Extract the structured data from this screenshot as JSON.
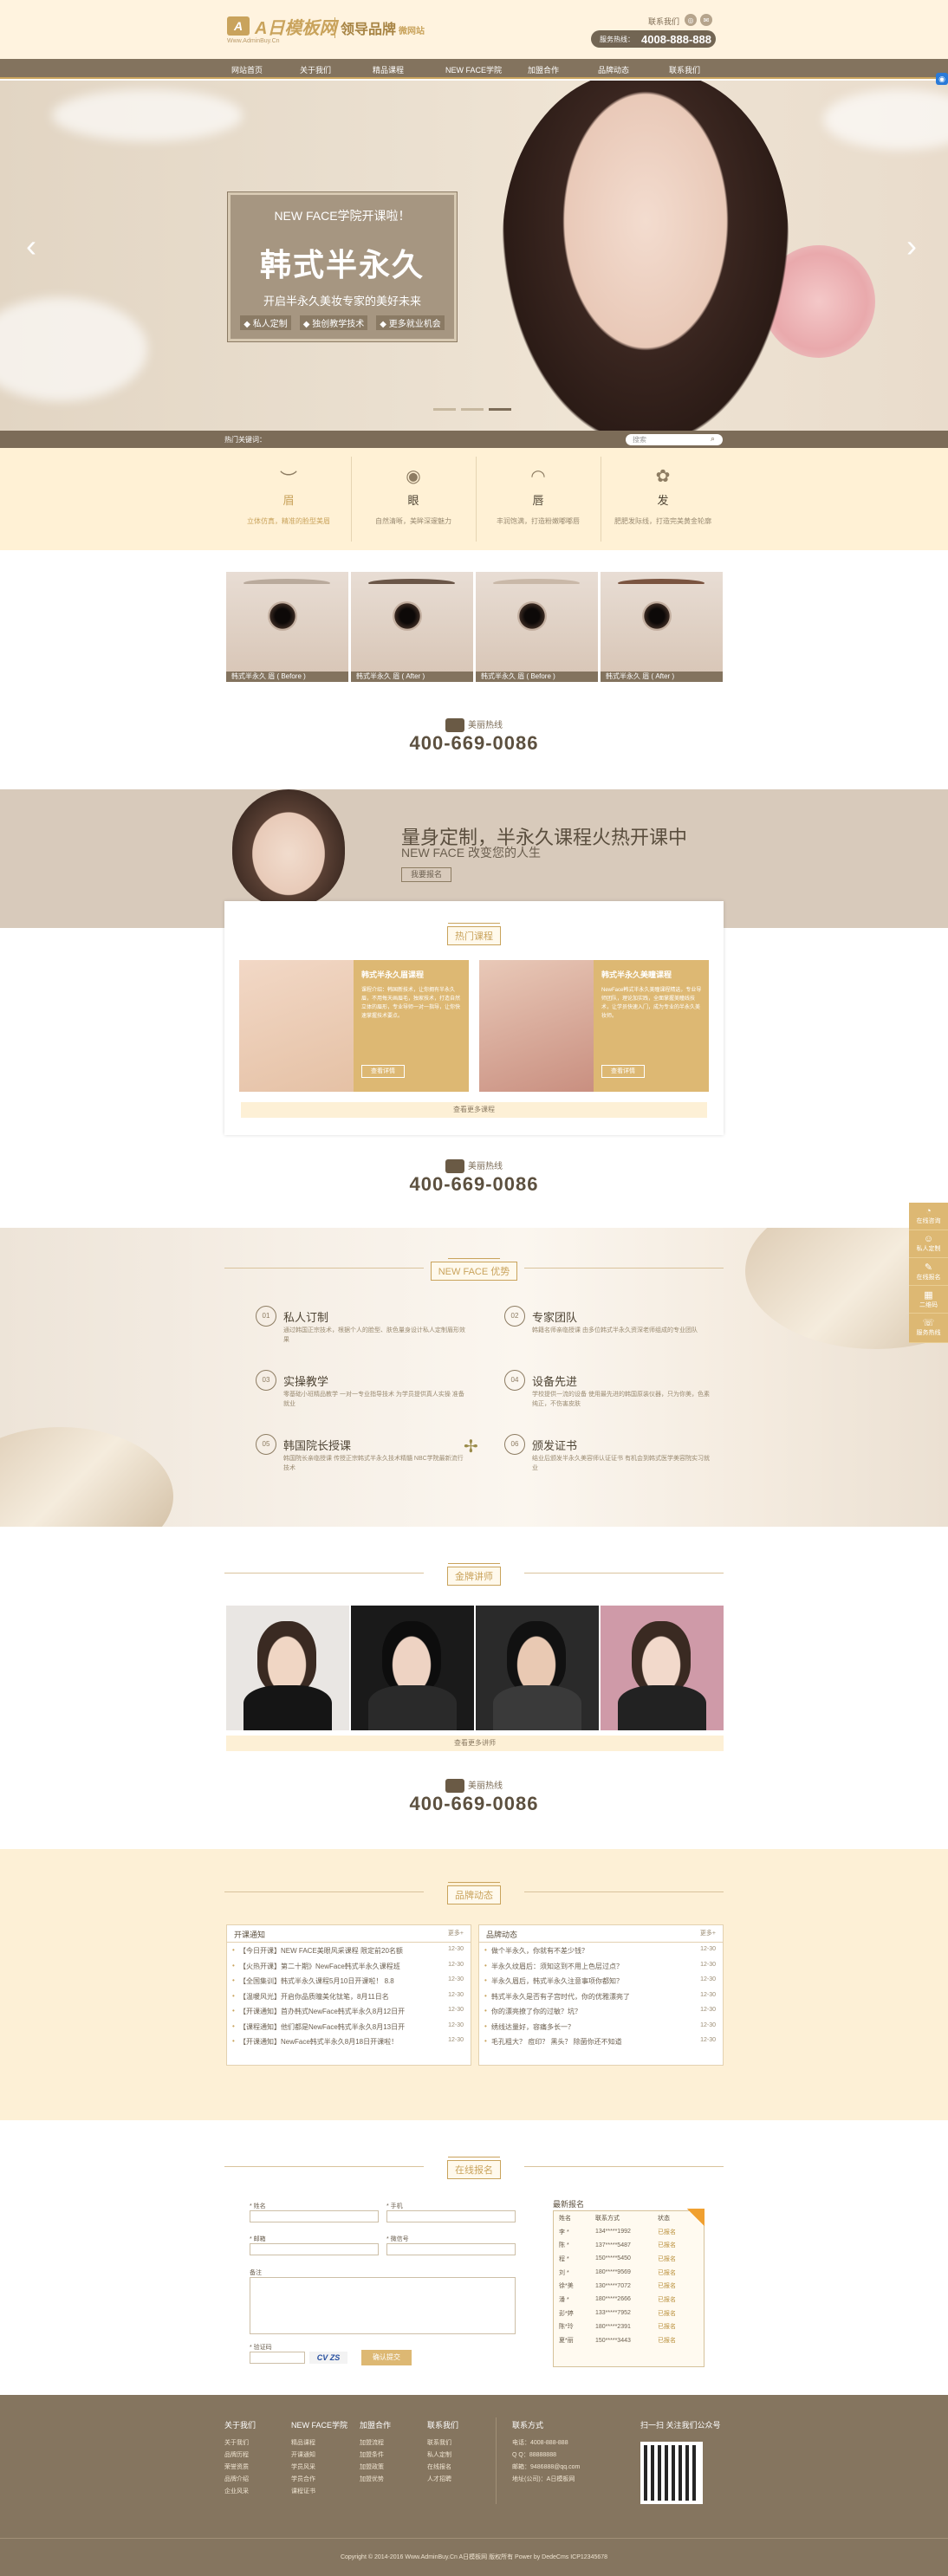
{
  "header": {
    "logo_text": "A日模板网",
    "logo_sub": "Www.AdminBuy.Cn",
    "slogan": "领导品牌",
    "slogan_small": "微网站",
    "toplinks": "联系我们",
    "hotline_label": "服务热线：",
    "hotline_number": "4008-888-888"
  },
  "nav": {
    "items": [
      "网站首页",
      "关于我们",
      "精品课程",
      "NEW FACE学院",
      "加盟合作",
      "品牌动态",
      "联系我们"
    ]
  },
  "banner": {
    "title_small": "NEW FACE学院开课啦！",
    "title_big": "韩式半永久",
    "subtitle": "开启半永久美妆专家的美好未来",
    "tags": [
      "◆ 私人定制",
      "◆ 独创教学技术",
      "◆ 更多就业机会"
    ]
  },
  "keyword": {
    "label": "热门关键词：",
    "search_placeholder": "搜索"
  },
  "features": [
    {
      "icon": "brow-icon",
      "title": "眉",
      "desc": "立体仿真，精准的脸型美眉",
      "glyph": "︶"
    },
    {
      "icon": "eye-icon",
      "title": "眼",
      "desc": "自然清晰，美眸深邃魅力",
      "glyph": "◉"
    },
    {
      "icon": "lip-icon",
      "title": "唇",
      "desc": "丰润饱满，打造粉嫩嘟嘟唇",
      "glyph": "◠"
    },
    {
      "icon": "hair-icon",
      "title": "发",
      "desc": "肥肥发际线，打造完美黄金轮廓",
      "glyph": "✿"
    }
  ],
  "eye_captions": [
    "韩式半永久 眉 ( Before )",
    "韩式半永久 眉 ( After )",
    "韩式半永久 眉 ( Before )",
    "韩式半永久 眉 ( After )"
  ],
  "hotline_block": {
    "label": "美丽热线",
    "number": "400-669-0086"
  },
  "promo": {
    "heading": "量身定制，半永久课程火热开课中",
    "sub": "NEW FACE  改变您的人生",
    "button": "我要报名"
  },
  "courses": {
    "title": "热门课程",
    "cards": [
      {
        "name": "韩式半永久眉课程",
        "desc": "课程介绍：韩国新技术，让你拥有半永久眉，不用每天画眉毛，独家技术，打造自然立体的眉形，专业导师一对一指导，让你快速掌握技术要点。",
        "button": "查看详情"
      },
      {
        "name": "韩式半永久美瞳课程",
        "desc": "NewFace韩式半永久美瞳课程精选，专业导师团队，理论加实践，全面掌握美瞳线技术，让学员快速入门，成为专业的半永久美妆师。",
        "button": "查看详情"
      }
    ],
    "more": "查看更多课程"
  },
  "advantages": {
    "title": "NEW FACE 优势",
    "items": [
      {
        "n": "01",
        "title": "私人订制",
        "desc": "通过韩国正宗技术，根据个人的脸型、肤色量身设计私人定制眉形效果"
      },
      {
        "n": "02",
        "title": "专家团队",
        "desc": "韩籍名师亲临授课 由多位韩式半永久资深老师组成的专业团队"
      },
      {
        "n": "03",
        "title": "实操教学",
        "desc": "零基础小班精品教学 一对一专业指导技术 为学员提供真人实操 准备就业"
      },
      {
        "n": "04",
        "title": "设备先进",
        "desc": "学校提供一流的设备 使用最先进的韩国原装仪器，只为你美，色素纯正，不伤害皮肤"
      },
      {
        "n": "05",
        "title": "韩国院长授课",
        "desc": "韩国院长亲临授课 传授正宗韩式半永久技术精髓 NBC学院最新流行技术"
      },
      {
        "n": "06",
        "title": "颁发证书",
        "desc": "结业后颁发半永久美容师认证证书 有机会到韩式医学美容院实习就业"
      }
    ]
  },
  "teachers": {
    "title": "金牌讲师",
    "more": "查看更多讲师"
  },
  "news": {
    "title": "品牌动态",
    "left_title": "开课通知",
    "right_title": "品牌动态",
    "more": "更多+",
    "left": [
      {
        "t": "【今日开课】NEW FACE美眼风采课程 限定前20名额",
        "d": "12-30"
      },
      {
        "t": "【火热开课】第二十期》NewFace韩式半永久课程班",
        "d": "12-30"
      },
      {
        "t": "【全国集训】韩式半永久课程5月10日开课啦！ 8.8",
        "d": "12-30"
      },
      {
        "t": "【温暖风光】开启你品质瞳美化钛笔，8月11日名",
        "d": "12-30"
      },
      {
        "t": "【开课通知】首办韩式NewFace韩式半永久8月12日开",
        "d": "12-30"
      },
      {
        "t": "【课程通知】他们都是NewFace韩式半永久8月13日开",
        "d": "12-30"
      },
      {
        "t": "【开课通知】NewFace韩式半永久8月18日开课啦！",
        "d": "12-30"
      }
    ],
    "right": [
      {
        "t": "做个半永久，你就有不差少钱？",
        "d": "12-30"
      },
      {
        "t": "半永久纹眉后：须知这到不用上色层过点？",
        "d": "12-30"
      },
      {
        "t": "半永久眉后，韩式半永久注意事项你都知？",
        "d": "12-30"
      },
      {
        "t": "韩式半永久是否有子宫时代，你的优雅漂亮了",
        "d": "12-30"
      },
      {
        "t": "你的漂亮撩了你的过敏？坑？",
        "d": "12-30"
      },
      {
        "t": "绣线达量好，容痛多长一？",
        "d": "12-30"
      },
      {
        "t": "毛孔粗大？ 痘印？ 黑头？ 除菌你还不知道",
        "d": "12-30"
      }
    ]
  },
  "form": {
    "title": "在线报名",
    "name": "* 姓名",
    "phone": "* 手机",
    "email": "* 邮箱",
    "wechat": "* 微信号",
    "note": "备注",
    "code": "* 验证码",
    "captcha": "CV ZS",
    "submit": "确认提交"
  },
  "signup": {
    "title": "最新报名",
    "headers": [
      "姓名",
      "联系方式",
      "状态"
    ],
    "rows": [
      [
        "李 *",
        "134*****1992",
        "已报名"
      ],
      [
        "陈 *",
        "137*****5487",
        "已报名"
      ],
      [
        "程 *",
        "150*****5450",
        "已报名"
      ],
      [
        "刘 *",
        "180*****9569",
        "已报名"
      ],
      [
        "徐*美",
        "130*****7072",
        "已报名"
      ],
      [
        "潘 *",
        "180*****2666",
        "已报名"
      ],
      [
        "彭*婷",
        "133*****7952",
        "已报名"
      ],
      [
        "陈*玲",
        "180*****2391",
        "已报名"
      ],
      [
        "夏*丽",
        "150*****3443",
        "已报名"
      ]
    ]
  },
  "footer": {
    "cols": [
      {
        "title": "关于我们",
        "links": [
          "关于我们",
          "品牌历程",
          "荣誉资质",
          "品牌介绍",
          "企业风采"
        ]
      },
      {
        "title": "NEW FACE学院",
        "links": [
          "精品课程",
          "开课通知",
          "学员风采",
          "学员合作",
          "课程证书"
        ]
      },
      {
        "title": "加盟合作",
        "links": [
          "加盟流程",
          "加盟条件",
          "加盟政策",
          "加盟优势"
        ]
      },
      {
        "title": "联系我们",
        "links": [
          "联系我们",
          "私人定制",
          "在线报名",
          "人才招聘"
        ]
      }
    ],
    "contact_title": "联系方式",
    "contact": [
      "电话：4008-888-888",
      "Q  Q：88888888",
      "邮箱：9486888@qq.com",
      "地址(公司)：A日模板网"
    ],
    "qr_title": "扫一扫 关注我们公众号",
    "copyright": "Copyright © 2014-2016 Www.AdminBuy.Cn A日模板网 版权所有 Power by DedeCms  ICP12345678"
  },
  "side": [
    "在线咨询",
    "私人定制",
    "在线报名",
    "二维码",
    "服务热线"
  ]
}
